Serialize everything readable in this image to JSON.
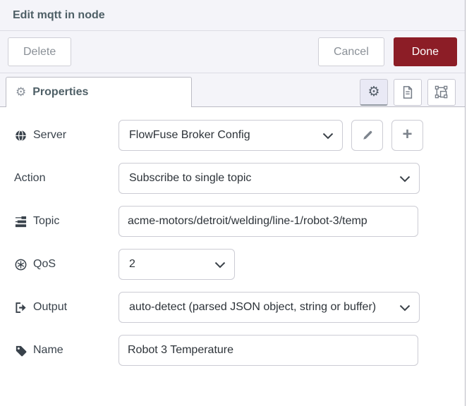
{
  "header": {
    "title": "Edit mqtt in node"
  },
  "toolbar": {
    "delete_label": "Delete",
    "cancel_label": "Cancel",
    "done_label": "Done"
  },
  "tabs": {
    "properties_label": "Properties",
    "icon_buttons": [
      "properties-gear-icon",
      "description-icon",
      "appearance-group-icon"
    ]
  },
  "form": {
    "server": {
      "label": "Server",
      "icon": "globe-icon",
      "value": "FlowFuse Broker Config"
    },
    "action": {
      "label": "Action",
      "icon": "",
      "value": "Subscribe to single topic"
    },
    "topic": {
      "label": "Topic",
      "icon": "tasks-icon",
      "value": "acme-motors/detroit/welding/line-1/robot-3/temp"
    },
    "qos": {
      "label": "QoS",
      "icon": "qos-circle-asterisk-icon",
      "value": "2"
    },
    "output": {
      "label": "Output",
      "icon": "sign-out-icon",
      "value": "auto-detect (parsed JSON object, string or buffer)"
    },
    "name": {
      "label": "Name",
      "icon": "tag-icon",
      "value": "Robot 3 Temperature"
    }
  },
  "colors": {
    "done_red": "#8c1d26",
    "header_bg": "#f4f4f9",
    "title_text": "#4e5f66",
    "label_text": "#39424b",
    "border": "#ccccd4"
  }
}
